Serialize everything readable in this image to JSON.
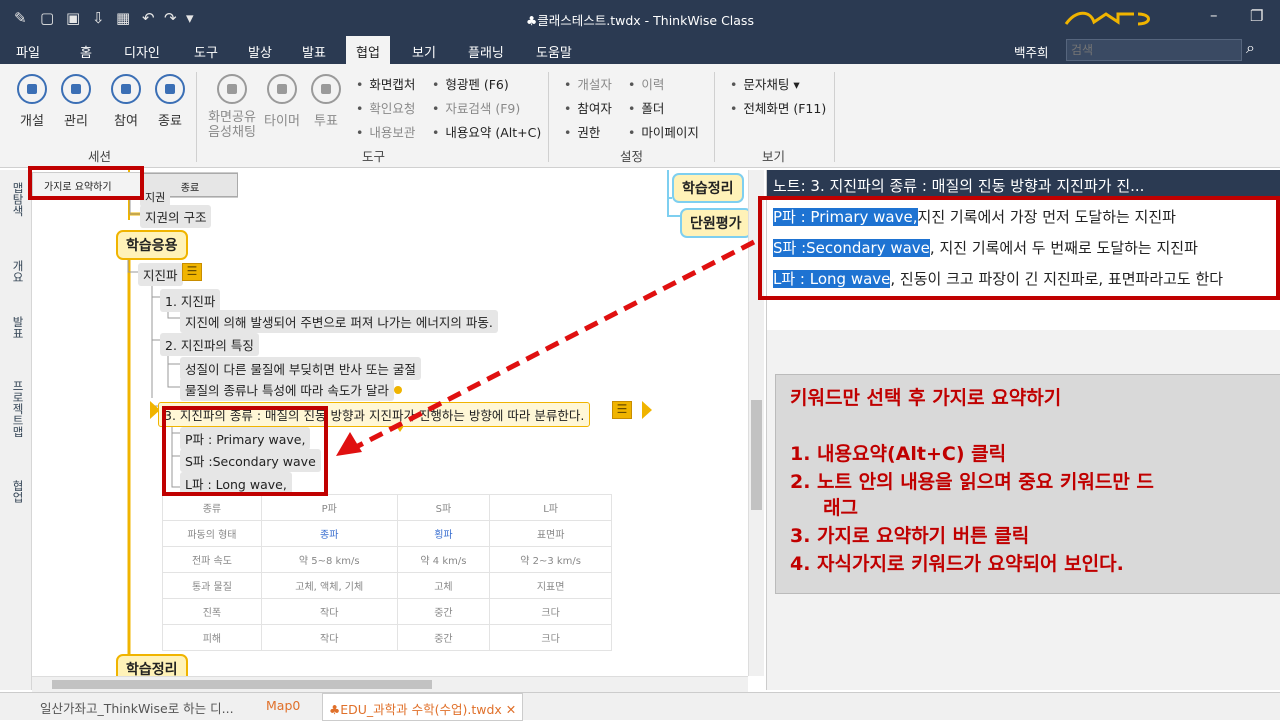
{
  "window": {
    "title": "♣클래스테스트.twdx - ThinkWise Class"
  },
  "menus": [
    "파일",
    "홈",
    "디자인",
    "도구",
    "발상",
    "발표",
    "협업",
    "보기",
    "플래닝",
    "도움말"
  ],
  "active_menu": "협업",
  "user": "백주희",
  "search": {
    "placeholder": "검색"
  },
  "ribbon": {
    "session": {
      "label": "세션",
      "buttons": [
        "개설",
        "관리",
        "참여",
        "종료"
      ]
    },
    "tools": {
      "label": "도구",
      "big_buttons": [
        "화면공유\n음성채팅",
        "타이머",
        "투표"
      ],
      "col1": [
        "화면캡처",
        "확인요청",
        "내용보관"
      ],
      "col2": [
        "형광펜 (F6)",
        "자료검색 (F9)",
        "내용요약 (Alt+C)"
      ]
    },
    "settings": {
      "label": "설정",
      "col1": [
        "개설자",
        "참여자",
        "권한"
      ],
      "col2": [
        "이력",
        "폴더",
        "마이페이지"
      ]
    },
    "view": {
      "label": "보기",
      "items": [
        "문자채팅 ▾",
        "전체화면 (F11)"
      ]
    }
  },
  "left_tabs": [
    "맵탐색",
    "개요",
    "발표",
    "프로젝트맵",
    "협업"
  ],
  "map": {
    "toolbar": {
      "summarize_btn": "가지로 요약하기",
      "end_btn": "종료"
    },
    "nodes": {
      "top_partial": "지권",
      "structure": "지권의 구조",
      "main1": "학습응용",
      "seismic": "지진파",
      "n1": "1. 지진파",
      "n1a": "지진에 의해 발생되어 주변으로 퍼져 나가는 에너지의 파동.",
      "n2": "2. 지진파의 특징",
      "n2a": "성질이 다른 물질에 부딪히면 반사 또는 굴절",
      "n2b": "물질의 종류나 특성에 따라 속도가 달라",
      "n3": "3. 지진파의 종류 : 매질의 진동 방향과 지진파가 진행하는 방향에 따라 분류한다.",
      "c1": "P파 : Primary wave,",
      "c2": "S파 :Secondary wave",
      "c3": "L파 : Long wave,",
      "main2": "학습정리",
      "right1": "학습정리",
      "right2": "단원평가"
    },
    "table": {
      "headers": [
        "종류",
        "P파",
        "S파",
        "L파"
      ],
      "rows": [
        [
          "파동의 형태",
          "종파",
          "횡파",
          "표면파"
        ],
        [
          "전파 속도",
          "약 5~8 km/s",
          "약 4 km/s",
          "약 2~3 km/s"
        ],
        [
          "통과 물질",
          "고체, 액체, 기체",
          "고체",
          "지표면"
        ],
        [
          "진폭",
          "작다",
          "중간",
          "크다"
        ],
        [
          "피해",
          "작다",
          "중간",
          "크다"
        ]
      ]
    }
  },
  "note": {
    "header": "노트: 3. 지진파의 종류 : 매질의 진동 방향과 지진파가 진...",
    "lines": [
      {
        "hl": "P파 : Primary wave,",
        "rest": "지진 기록에서 가장 먼저 도달하는 지진파"
      },
      {
        "hl": "S파 :Secondary wave",
        "rest": ", 지진 기록에서 두 번째로 도달하는 지진파"
      },
      {
        "hl": "L파 : Long wave",
        "rest": ", 진동이 크고 파장이 긴 지진파로, 표면파라고도 한다"
      }
    ]
  },
  "instructions": {
    "title": "키워드만 선택 후 가지로 요약하기",
    "steps": [
      "1.  내용요약(Alt+C) 클릭",
      "2.  노트 안의 내용을 읽으며 중요 키워드만 드",
      "     래그",
      "3.  가지로 요약하기 버튼 클릭",
      "4.  자식가지로 키워드가 요약되어 보인다."
    ]
  },
  "bottom_tabs": [
    "일산가좌고_ThinkWise로 하는 디...",
    "Map0",
    "♣EDU_과학과 수학(수업).twdx ✕"
  ]
}
